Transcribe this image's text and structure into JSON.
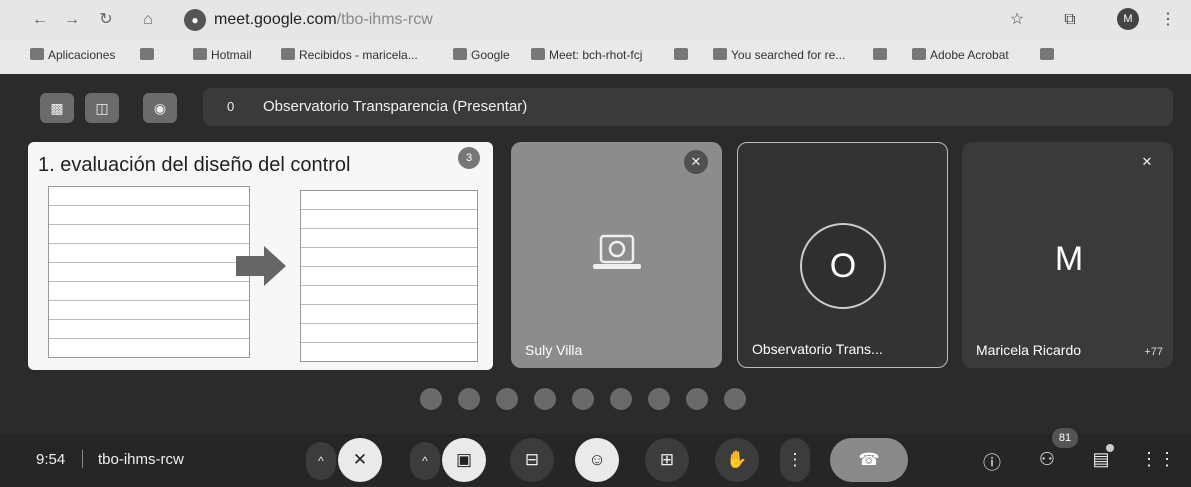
{
  "browser": {
    "url_main": "meet.google.com",
    "url_path": "/tbo-ihms-rcw",
    "profile_initial": "M"
  },
  "bookmarks": [
    "Aplicaciones",
    "Hotmail",
    "Recibidos - maricela...",
    "Google",
    "Meet: bch-rhot-fcj",
    "You searched for re...",
    "Adobe Acrobat"
  ],
  "meeting": {
    "presenter_count": "0",
    "presenter_title": "Observatorio Transparencia (Presentar)",
    "slide_title": "1. evaluación del diseño del control",
    "slide_badge": "3",
    "tiles": [
      {
        "label": "Suly Villa"
      },
      {
        "label": "Observatorio Trans...",
        "initial": "O"
      },
      {
        "label": "Maricela Ricardo",
        "initial": "M",
        "extra": "+77"
      }
    ],
    "clock": "9:54",
    "meeting_code": "tbo-ihms-rcw",
    "participants_count": "81"
  },
  "colors": {
    "meet_bg": "#2b2b2b",
    "tile_gray": "#8a8a8a",
    "end_call": "#8a8a8a"
  },
  "icons": {
    "back": "arrow-left-icon",
    "forward": "arrow-right-icon",
    "reload": "reload-icon",
    "home": "home-icon",
    "star": "star-icon",
    "mic_off": "mic-off-icon",
    "camera_off": "camera-off-icon",
    "captions": "captions-icon",
    "emoji": "emoji-icon",
    "present": "present-icon",
    "hand": "raise-hand-icon",
    "more": "more-vert-icon",
    "end_call": "end-call-icon",
    "info": "info-icon",
    "people": "people-icon",
    "chat": "chat-icon",
    "activities": "apps-grid-icon"
  }
}
